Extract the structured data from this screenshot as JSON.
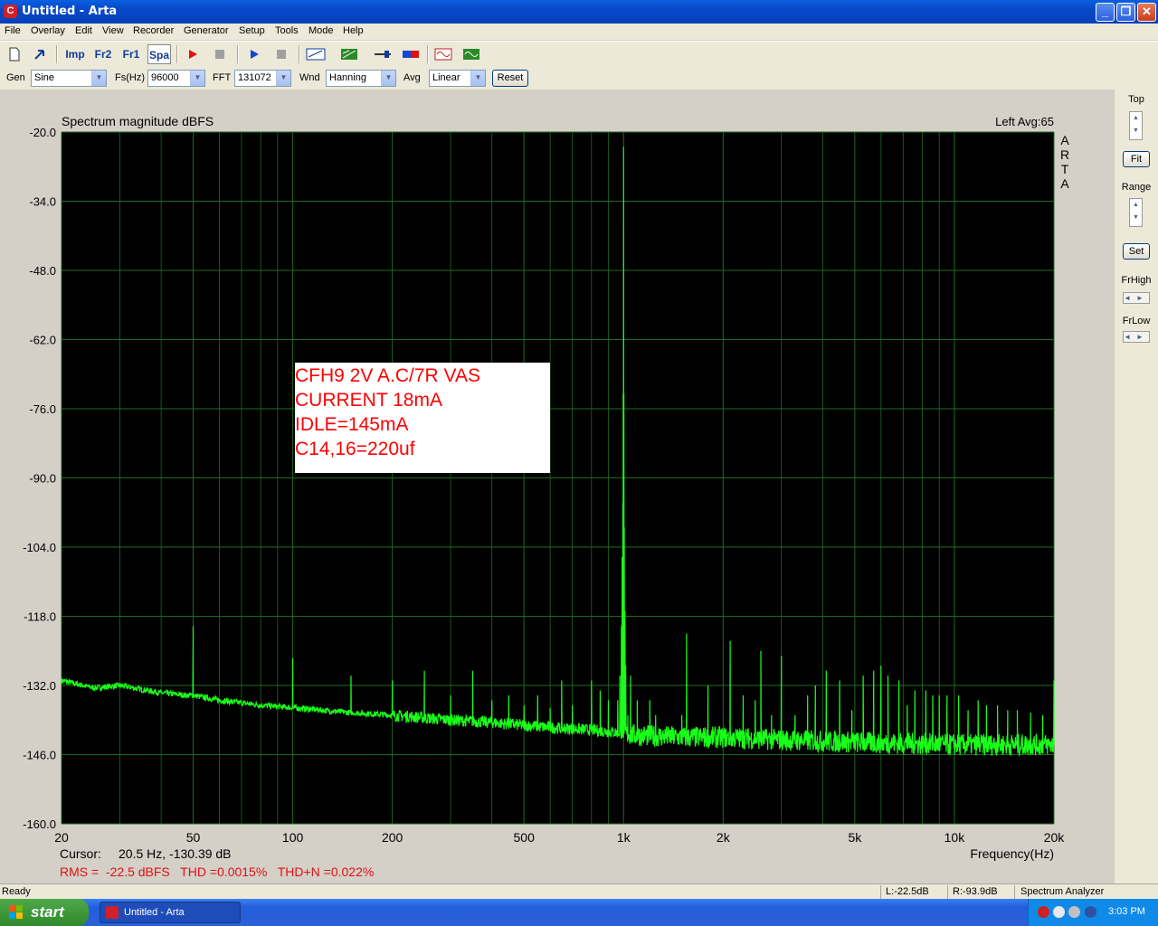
{
  "window": {
    "title": "Untitled - Arta"
  },
  "menu": [
    "File",
    "Overlay",
    "Edit",
    "View",
    "Recorder",
    "Generator",
    "Setup",
    "Tools",
    "Mode",
    "Help"
  ],
  "toolbar": {
    "imp": "Imp",
    "fr2": "Fr2",
    "fr1": "Fr1",
    "spa": "Spa"
  },
  "genbar": {
    "gen_label": "Gen",
    "gen_value": "Sine",
    "fs_label": "Fs(Hz)",
    "fs_value": "96000",
    "fft_label": "FFT",
    "fft_value": "131072",
    "wnd_label": "Wnd",
    "wnd_value": "Hanning",
    "avg_label": "Avg",
    "avg_value": "Linear",
    "reset": "Reset"
  },
  "plot": {
    "title": "Spectrum magnitude dBFS",
    "channel_avg": "Left  Avg:65",
    "brand": "ARTA",
    "annotation": [
      "CFH9 2V A.C/7R VAS",
      "CURRENT 18mA",
      "IDLE=145mA",
      "C14,16=220uf"
    ],
    "cursor_label": "Cursor:",
    "cursor_value": "20.5 Hz, -130.39 dB",
    "measure": "RMS =  -22.5 dBFS   THD =0.0015%   THD+N =0.022%",
    "xlabel": "Frequency(Hz)"
  },
  "right_panel": {
    "top": "Top",
    "fit": "Fit",
    "range": "Range",
    "set": "Set",
    "frhigh": "FrHigh",
    "frlow": "FrLow"
  },
  "status": {
    "ready": "Ready",
    "left": "L:-22.5dB",
    "right": "R:-93.9dB",
    "mode": "Spectrum Analyzer"
  },
  "taskbar": {
    "start": "start",
    "task": "Untitled - Arta",
    "clock": "3:03 PM"
  },
  "colors": {
    "trace": "#19ff19",
    "grid": "#1f6b1f",
    "plot_bg": "#000000",
    "annotation": "#ff0000"
  },
  "chart_data": {
    "type": "line",
    "title": "Spectrum magnitude dBFS",
    "xlabel": "Frequency(Hz)",
    "ylabel": "",
    "x_scale": "log",
    "xlim": [
      20,
      20000
    ],
    "ylim": [
      -160,
      -20
    ],
    "x_ticks": [
      20,
      50,
      100,
      200,
      500,
      1000,
      2000,
      5000,
      10000,
      20000
    ],
    "x_tick_labels": [
      "20",
      "50",
      "100",
      "200",
      "500",
      "1k",
      "2k",
      "5k",
      "10k",
      "20k"
    ],
    "y_ticks": [
      -20,
      -34,
      -48,
      -62,
      -76,
      -90,
      -104,
      -118,
      -132,
      -146,
      -160
    ],
    "y_tick_labels": [
      "-20.0",
      "-34.0",
      "-48.0",
      "-62.0",
      "-76.0",
      "-90.0",
      "-104.0",
      "-118.0",
      "-132.0",
      "-146.0",
      "-160.0"
    ],
    "grid": true,
    "series": [
      {
        "noise_floor": [
          [
            20,
            -131
          ],
          [
            25,
            -132.5
          ],
          [
            30,
            -132
          ],
          [
            40,
            -133.5
          ],
          [
            48,
            -134
          ],
          [
            50,
            -134
          ],
          [
            60,
            -135
          ],
          [
            80,
            -136
          ],
          [
            100,
            -136.5
          ],
          [
            150,
            -137.5
          ],
          [
            200,
            -138
          ],
          [
            300,
            -139
          ],
          [
            400,
            -139.5
          ],
          [
            600,
            -140.5
          ],
          [
            800,
            -141
          ],
          [
            950,
            -141.5
          ],
          [
            1050,
            -142
          ],
          [
            1500,
            -142.5
          ],
          [
            2000,
            -142.5
          ],
          [
            3000,
            -143
          ],
          [
            5000,
            -143.5
          ],
          [
            10000,
            -144
          ],
          [
            20000,
            -144
          ]
        ],
        "peaks": [
          [
            50,
            -120
          ],
          [
            100,
            -126.5
          ],
          [
            150,
            -130
          ],
          [
            200,
            -131
          ],
          [
            250,
            -129
          ],
          [
            300,
            -134
          ],
          [
            350,
            -129
          ],
          [
            400,
            -135
          ],
          [
            450,
            -134
          ],
          [
            500,
            -136
          ],
          [
            550,
            -134
          ],
          [
            600,
            -136.5
          ],
          [
            650,
            -131
          ],
          [
            700,
            -136
          ],
          [
            800,
            -131
          ],
          [
            850,
            -133
          ],
          [
            900,
            -135
          ],
          [
            1000,
            -23
          ],
          [
            1050,
            -130
          ],
          [
            1100,
            -135
          ],
          [
            1200,
            -135
          ],
          [
            1250,
            -138
          ],
          [
            1500,
            -138
          ],
          [
            1550,
            -121.5
          ],
          [
            1800,
            -132
          ],
          [
            2100,
            -123
          ],
          [
            2300,
            -134
          ],
          [
            2500,
            -135
          ],
          [
            2600,
            -125
          ],
          [
            2800,
            -138
          ],
          [
            3000,
            -126
          ],
          [
            3300,
            -138
          ],
          [
            3600,
            -134
          ],
          [
            3800,
            -132
          ],
          [
            4100,
            -129
          ],
          [
            4500,
            -131
          ],
          [
            4900,
            -137
          ],
          [
            5300,
            -130
          ],
          [
            5700,
            -129
          ],
          [
            6000,
            -128
          ],
          [
            6300,
            -130
          ],
          [
            6800,
            -131
          ],
          [
            7200,
            -136
          ],
          [
            7600,
            -133
          ],
          [
            8200,
            -133
          ],
          [
            8600,
            -134
          ],
          [
            9000,
            -134
          ],
          [
            9500,
            -134
          ],
          [
            10300,
            -134
          ],
          [
            11000,
            -137
          ],
          [
            11800,
            -135
          ],
          [
            12500,
            -136
          ],
          [
            13500,
            -136
          ],
          [
            14500,
            -137
          ],
          [
            15500,
            -137
          ],
          [
            17000,
            -137.5
          ],
          [
            18500,
            -138
          ],
          [
            20000,
            -131
          ]
        ],
        "fundamental_skirt": [
          [
            960,
            -135
          ],
          [
            975,
            -130
          ],
          [
            985,
            -120
          ],
          [
            990,
            -106
          ],
          [
            995,
            -95
          ],
          [
            998,
            -73
          ],
          [
            1000,
            -23
          ],
          [
            1002,
            -73
          ],
          [
            1005,
            -100
          ],
          [
            1010,
            -117
          ],
          [
            1015,
            -128
          ],
          [
            1030,
            -138
          ]
        ]
      }
    ]
  }
}
